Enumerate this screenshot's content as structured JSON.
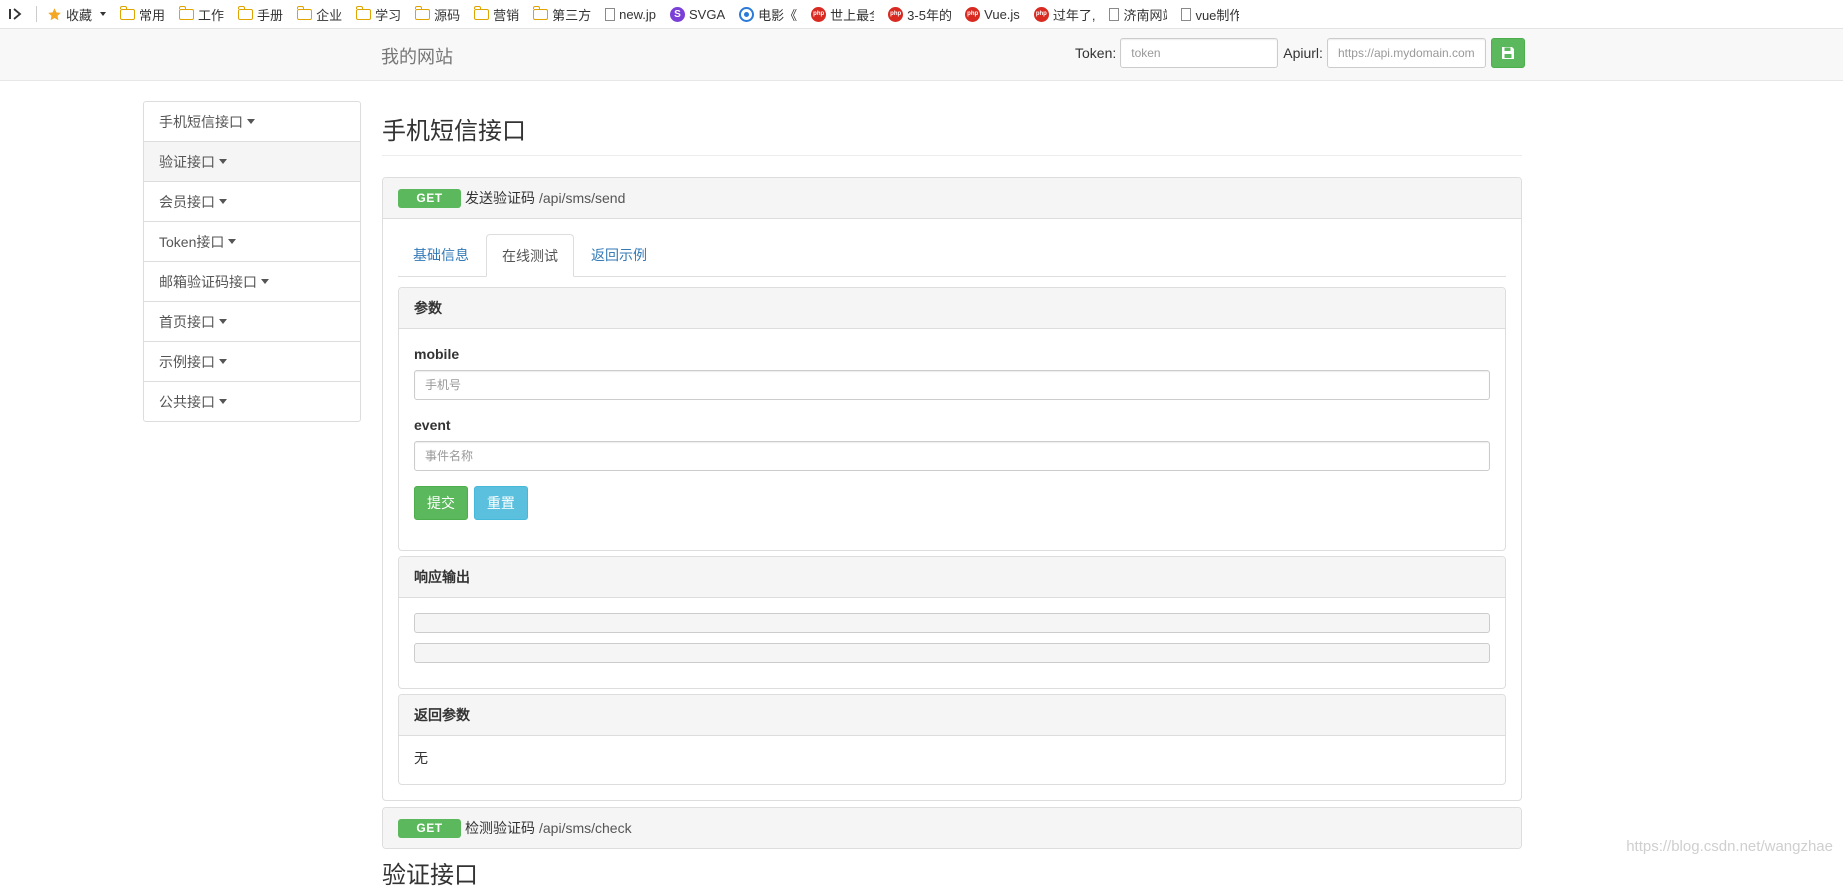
{
  "bookmarks": {
    "items": [
      {
        "label": "收藏",
        "icon": "star-icon"
      },
      {
        "label": "常用",
        "icon": "folder-icon"
      },
      {
        "label": "工作",
        "icon": "folder-icon"
      },
      {
        "label": "手册",
        "icon": "folder-icon"
      },
      {
        "label": "企业",
        "icon": "folder-icon"
      },
      {
        "label": "学习",
        "icon": "folder-icon"
      },
      {
        "label": "源码",
        "icon": "folder-icon"
      },
      {
        "label": "营销",
        "icon": "folder-icon"
      },
      {
        "label": "第三方",
        "icon": "folder-icon"
      },
      {
        "label": "new.jp",
        "icon": "page-icon"
      },
      {
        "label": "SVGA",
        "icon": "svga-icon"
      },
      {
        "label": "电影《",
        "icon": "eye-icon"
      },
      {
        "label": "世上最全",
        "icon": "php-icon"
      },
      {
        "label": "3-5年的",
        "icon": "php-icon"
      },
      {
        "label": "Vue.js",
        "icon": "php-icon"
      },
      {
        "label": "过年了,",
        "icon": "php-icon"
      },
      {
        "label": "济南网站",
        "icon": "page-icon"
      },
      {
        "label": "vue制作",
        "icon": "page-icon"
      }
    ]
  },
  "navbar": {
    "brand": "我的网站",
    "token_label": "Token:",
    "token_placeholder": "token",
    "apiurl_label": "Apiurl:",
    "apiurl_placeholder": "https://api.mydomain.com"
  },
  "sidebar": {
    "items": [
      {
        "label": "手机短信接口"
      },
      {
        "label": "验证接口"
      },
      {
        "label": "会员接口"
      },
      {
        "label": "Token接口"
      },
      {
        "label": "邮箱验证码接口"
      },
      {
        "label": "首页接口"
      },
      {
        "label": "示例接口"
      },
      {
        "label": "公共接口"
      }
    ]
  },
  "main": {
    "title": "手机短信接口",
    "api1": {
      "method": "GET",
      "name": "发送验证码",
      "path": "/api/sms/send",
      "tabs": [
        "基础信息",
        "在线测试",
        "返回示例"
      ],
      "params_title": "参数",
      "fields": [
        {
          "label": "mobile",
          "placeholder": "手机号"
        },
        {
          "label": "event",
          "placeholder": "事件名称"
        }
      ],
      "submit_label": "提交",
      "reset_label": "重置",
      "response_title": "响应输出",
      "return_title": "返回参数",
      "return_value": "无"
    },
    "api2": {
      "method": "GET",
      "name": "检测验证码",
      "path": "/api/sms/check"
    },
    "next_section_title": "验证接口"
  },
  "watermark": "https://blog.csdn.net/wangzhae"
}
